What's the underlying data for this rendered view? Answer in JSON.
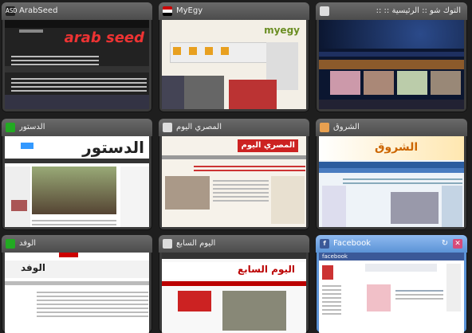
{
  "tiles": [
    {
      "title": "ArabSeed",
      "favicon": "ASD",
      "site_text": "arab seed"
    },
    {
      "title": "MyEgy",
      "favicon": "flag",
      "site_text": "myegy"
    },
    {
      "title": "التوك شو :: الرئيسية :: ::",
      "favicon": "page"
    },
    {
      "title": "الدستور",
      "favicon": "dst",
      "site_text": "الدستور"
    },
    {
      "title": "المصري اليوم",
      "favicon": "page",
      "site_text": "المصري اليوم"
    },
    {
      "title": "الشروق",
      "favicon": "shr",
      "site_text": "الشروق"
    },
    {
      "title": "الوفد",
      "favicon": "wfd",
      "site_text": "الوفد"
    },
    {
      "title": "اليوم السابع",
      "favicon": "page",
      "site_text": "اليوم السابع"
    },
    {
      "title": "Facebook",
      "favicon": "f",
      "site_text": "facebook"
    }
  ],
  "active_tile_buttons": {
    "reload": "↻",
    "close": "✕"
  },
  "colors": {
    "active": "#5b93d6",
    "tile": "#3a3a3a",
    "close": "#d64b7a"
  }
}
